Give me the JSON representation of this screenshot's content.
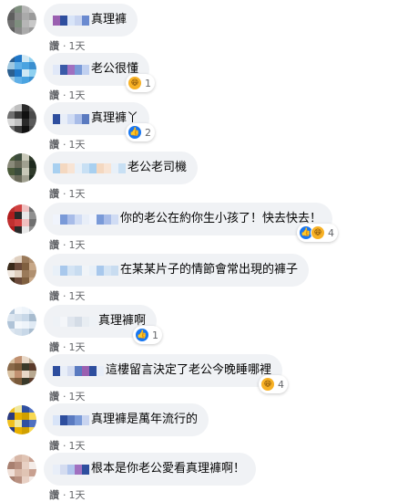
{
  "labels": {
    "like": "讚",
    "dot": "·",
    "age": "1天"
  },
  "colors": {
    "bubble": "#f0f2f5",
    "like_blue": "#1877f2",
    "haha_yellow": "#f7b125",
    "meta_gray": "#65676b"
  },
  "comments": [
    {
      "text": "真理褲",
      "reactions": [],
      "reaction_count": ""
    },
    {
      "text": "老公很懂",
      "reactions": [
        "haha-icon"
      ],
      "reaction_count": "1"
    },
    {
      "text": "真理褲丫",
      "reactions": [
        "like-icon"
      ],
      "reaction_count": "2"
    },
    {
      "text": "老公老司機",
      "reactions": [],
      "reaction_count": ""
    },
    {
      "text": "你的老公在約你生小孩了！快去快去！",
      "reactions": [
        "like-icon",
        "haha-icon"
      ],
      "reaction_count": "4"
    },
    {
      "text": "在某某片子的情節會常出現的褲子",
      "reactions": [],
      "reaction_count": ""
    },
    {
      "text": "真理褲啊",
      "reactions": [
        "like-icon"
      ],
      "reaction_count": "1"
    },
    {
      "text": "這樓留言決定了老公今晚睡哪裡",
      "reactions": [
        "haha-icon"
      ],
      "reaction_count": "4"
    },
    {
      "text": "真理褲是萬年流行的",
      "reactions": [],
      "reaction_count": ""
    },
    {
      "text": "根本是你老公愛看真理褲啊！",
      "reactions": [],
      "reaction_count": ""
    }
  ]
}
